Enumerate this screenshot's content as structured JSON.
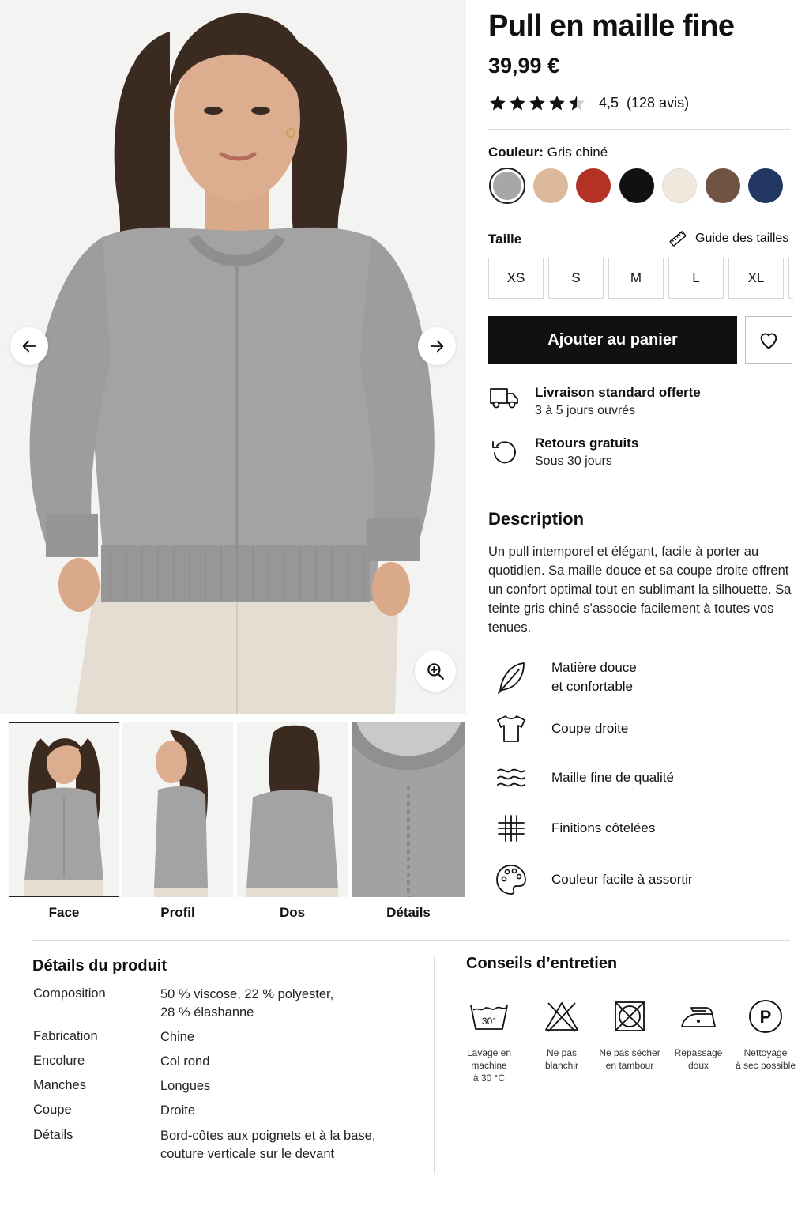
{
  "gallery": {
    "prev_icon": "arrow-left-icon",
    "next_icon": "arrow-right-icon",
    "zoom_icon": "zoom-in-icon",
    "thumbnails": [
      {
        "label": "Face"
      },
      {
        "label": "Profil"
      },
      {
        "label": "Dos"
      },
      {
        "label": "Détails"
      }
    ]
  },
  "product": {
    "title": "Pull en maille fine",
    "price": "39,99 €",
    "rating": 4.5,
    "rating_value": "4,5",
    "reviews": "(128 avis)"
  },
  "color": {
    "label": "Couleur:",
    "selected": "Gris chiné",
    "swatches": [
      "#a7a7a7",
      "#dcb99a",
      "#b33224",
      "#111111",
      "#efe8dd",
      "#6f5443",
      "#223761"
    ]
  },
  "size": {
    "label": "Taille",
    "guide": "Guide des tailles",
    "guide_icon": "ruler-icon",
    "options": [
      "XS",
      "S",
      "M",
      "L",
      "XL"
    ]
  },
  "actions": {
    "add_to_cart": "Ajouter au panier",
    "wishlist_icon": "heart-icon"
  },
  "shipping": [
    {
      "icon": "truck-icon",
      "title": "Livraison standard offerte",
      "subtitle": "3 à 5 jours ouvrés"
    },
    {
      "icon": "return-icon",
      "title": "Retours gratuits",
      "subtitle": "Sous 30 jours"
    }
  ],
  "description": {
    "heading": "Description",
    "text": "Un pull intemporel et élégant, facile à porter au quotidien. Sa maille douce et sa coupe droite offrent un confort optimal tout en sublimant la silhouette. Sa teinte gris chiné s’associe facilement à toutes vos tenues."
  },
  "features": [
    {
      "icon": "leaf-icon",
      "line1": "Matière douce",
      "line2": "et confortable"
    },
    {
      "icon": "tshirt-icon",
      "line1": "Coupe droite",
      "line2": ""
    },
    {
      "icon": "waves-icon",
      "line1": "Maille fine de qualité",
      "line2": ""
    },
    {
      "icon": "grid-icon",
      "line1": "Finitions côtelées",
      "line2": ""
    },
    {
      "icon": "palette-icon",
      "line1": "Couleur facile à assortir",
      "line2": ""
    }
  ],
  "details": {
    "heading": "Détails du produit",
    "rows": [
      {
        "key": "Composition",
        "value1": "50 % viscose, 22 % polyester,",
        "value2": "28 % élashanne"
      },
      {
        "key": "Fabrication",
        "value1": "Chine",
        "value2": ""
      },
      {
        "key": "Encolure",
        "value1": "Col rond",
        "value2": ""
      },
      {
        "key": "Manches",
        "value1": "Longues",
        "value2": ""
      },
      {
        "key": "Coupe",
        "value1": "Droite",
        "value2": ""
      },
      {
        "key": "Détails",
        "value1": "Bord-côtes aux poignets et à la base,",
        "value2": "couture verticale sur le devant"
      }
    ]
  },
  "care": {
    "heading": "Conseils d’entretien",
    "temp": "30°",
    "items": [
      {
        "icon": "wash-30-icon",
        "line1": "Lavage en machine",
        "line2": "à 30 °C"
      },
      {
        "icon": "no-bleach-icon",
        "line1": "Ne pas",
        "line2": "blanchir"
      },
      {
        "icon": "no-tumble-dry-icon",
        "line1": "Ne pas sécher",
        "line2": "en tambour"
      },
      {
        "icon": "iron-low-icon",
        "line1": "Repassage",
        "line2": "doux"
      },
      {
        "icon": "dry-clean-p-icon",
        "line1": "Nettoyage",
        "line2": "à sec possible",
        "letter": "P"
      }
    ]
  }
}
